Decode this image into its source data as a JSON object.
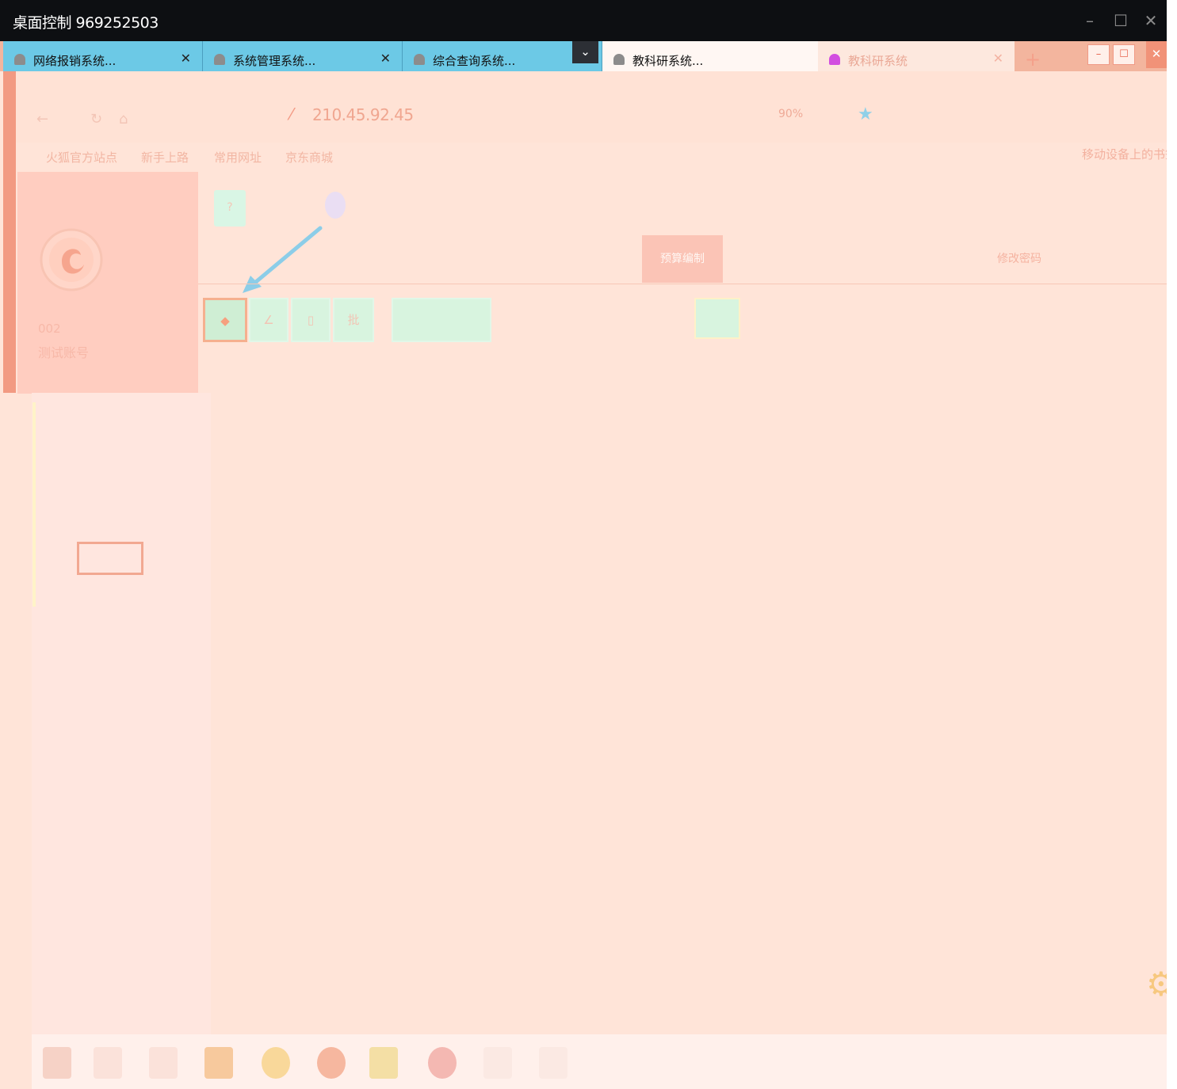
{
  "window": {
    "title": "桌面控制 969252503"
  },
  "tabs": [
    {
      "label": "网络报销系统..."
    },
    {
      "label": "系统管理系统..."
    },
    {
      "label": "综合查询系统..."
    },
    {
      "label": "教科研系统..."
    },
    {
      "label": "教科研系统"
    }
  ],
  "browser": {
    "address": "210.45.92.45",
    "zoom": "90%",
    "bookmarks": [
      "火狐官方站点",
      "新手上路",
      "常用网址",
      "京东商城"
    ],
    "bookmarks_right": "移动设备上的书签"
  },
  "account": {
    "id": "002",
    "name": "测试账号"
  },
  "content": {
    "reserve_button": "预算编制",
    "edit_password": "修改密码",
    "tool_buttons": [
      "◆",
      "∠",
      "▯",
      "批"
    ]
  },
  "colors": {
    "titlebar": "#0d0f12",
    "tab_active": "#6cc9e6",
    "tint": "#ffe4d8",
    "accent": "#f29a82"
  },
  "icons": {
    "window_minimize": "–",
    "window_maximize": "☐",
    "window_close": "✕",
    "tab_close": "✕",
    "tab_dropdown": "⌄",
    "new_tab": "+",
    "star": "★",
    "gear": "⚙"
  }
}
